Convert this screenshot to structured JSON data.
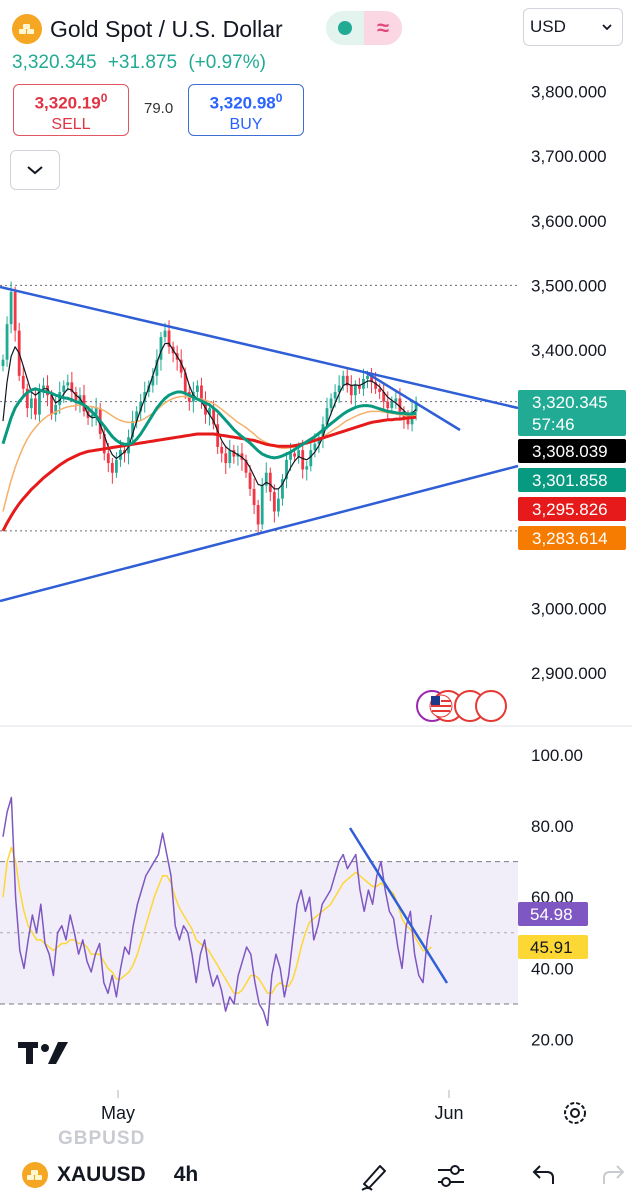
{
  "header": {
    "title": "Gold Spot / U.S. Dollar",
    "last_price": "3,320.345",
    "change": "+31.875",
    "change_pct": "(+0.97%)",
    "sell": {
      "price_main": "3,320.19",
      "price_sup": "0",
      "label": "SELL"
    },
    "buy": {
      "price_main": "3,320.98",
      "price_sup": "0",
      "label": "BUY"
    },
    "spread": "79.0",
    "currency": "USD",
    "delay_icon": "≈"
  },
  "colors": {
    "up": "#22ab94",
    "down": "#f23645",
    "trendline": "#2f5ed6",
    "ma_black": "#131722",
    "ma_green": "#089981",
    "ma_red": "#e61a1a",
    "ma_orange": "#f5b06a",
    "rsi": "#7e57c2",
    "rsi_ma": "#fdd835"
  },
  "chart_data": [
    {
      "type": "candlestick",
      "symbol": "XAUUSD",
      "interval": "4h",
      "y_ticks": [
        "3,800.000",
        "3,700.000",
        "3,600.000",
        "3,500.000",
        "3,400.000",
        "3,000.000",
        "2,900.000"
      ],
      "ylim": [
        2860,
        3860
      ],
      "x_ticks": [
        "May",
        "Jun"
      ],
      "price_labels": [
        {
          "value": 3320.345,
          "text": "3,320.345",
          "sub": "57:46",
          "color": "#22ab94"
        },
        {
          "value": 3308.039,
          "text": "3,308.039",
          "color": "#000000"
        },
        {
          "value": 3301.858,
          "text": "3,301.858",
          "color": "#089981"
        },
        {
          "value": 3295.826,
          "text": "3,295.826",
          "color": "#e61a1a"
        },
        {
          "value": 3283.614,
          "text": "3,283.614",
          "color": "#f57c00"
        }
      ],
      "horizontal_levels": [
        3500,
        3320,
        3120
      ],
      "close_series": [
        3385,
        3440,
        3490,
        3430,
        3360,
        3340,
        3310,
        3325,
        3300,
        3340,
        3345,
        3330,
        3300,
        3315,
        3335,
        3345,
        3350,
        3335,
        3320,
        3330,
        3305,
        3295,
        3300,
        3310,
        3270,
        3240,
        3225,
        3210,
        3230,
        3245,
        3240,
        3265,
        3290,
        3305,
        3320,
        3335,
        3345,
        3360,
        3385,
        3420,
        3430,
        3405,
        3395,
        3385,
        3365,
        3335,
        3320,
        3335,
        3345,
        3320,
        3300,
        3310,
        3285,
        3250,
        3240,
        3225,
        3245,
        3235,
        3240,
        3230,
        3210,
        3185,
        3160,
        3130,
        3190,
        3210,
        3180,
        3150,
        3170,
        3200,
        3230,
        3240,
        3235,
        3245,
        3215,
        3220,
        3245,
        3255,
        3265,
        3285,
        3310,
        3325,
        3335,
        3345,
        3360,
        3345,
        3330,
        3345,
        3340,
        3355,
        3360,
        3350,
        3340,
        3335,
        3320,
        3310,
        3320,
        3325,
        3305,
        3295,
        3285,
        3305,
        3320
      ],
      "ema_black": [
        3290,
        3350,
        3390,
        3405,
        3395,
        3375,
        3355,
        3335,
        3330,
        3335,
        3340,
        3340,
        3330,
        3318,
        3322,
        3332,
        3340,
        3338,
        3330,
        3325,
        3315,
        3300,
        3295,
        3296,
        3285,
        3268,
        3250,
        3238,
        3232,
        3237,
        3242,
        3250,
        3270,
        3290,
        3308,
        3325,
        3342,
        3360,
        3380,
        3398,
        3410,
        3410,
        3400,
        3390,
        3380,
        3365,
        3345,
        3330,
        3325,
        3320,
        3310,
        3300,
        3290,
        3275,
        3260,
        3250,
        3245,
        3242,
        3238,
        3234,
        3228,
        3218,
        3205,
        3192,
        3190,
        3195,
        3192,
        3185,
        3185,
        3192,
        3205,
        3218,
        3228,
        3235,
        3232,
        3230,
        3235,
        3242,
        3252,
        3266,
        3285,
        3302,
        3318,
        3332,
        3345,
        3348,
        3345,
        3346,
        3345,
        3348,
        3352,
        3352,
        3348,
        3343,
        3335,
        3327,
        3322,
        3318,
        3312,
        3306,
        3300,
        3302,
        3308
      ],
      "sma_green": [
        3255,
        3275,
        3295,
        3310,
        3320,
        3328,
        3334,
        3338,
        3340,
        3338,
        3336,
        3335,
        3333,
        3330,
        3328,
        3326,
        3325,
        3323,
        3320,
        3318,
        3315,
        3310,
        3304,
        3298,
        3290,
        3282,
        3274,
        3266,
        3260,
        3256,
        3254,
        3254,
        3256,
        3262,
        3270,
        3280,
        3290,
        3300,
        3310,
        3318,
        3325,
        3330,
        3333,
        3335,
        3335,
        3333,
        3330,
        3327,
        3324,
        3321,
        3318,
        3315,
        3310,
        3305,
        3298,
        3291,
        3284,
        3277,
        3271,
        3266,
        3261,
        3256,
        3250,
        3244,
        3239,
        3236,
        3234,
        3233,
        3234,
        3236,
        3239,
        3242,
        3246,
        3250,
        3254,
        3258,
        3262,
        3266,
        3271,
        3276,
        3281,
        3286,
        3291,
        3296,
        3301,
        3305,
        3308,
        3311,
        3313,
        3314,
        3314,
        3313,
        3311,
        3309,
        3307,
        3305,
        3304,
        3303,
        3302,
        3302,
        3301,
        3301,
        3302
      ],
      "sma_red": [
        3120,
        3132,
        3143,
        3153,
        3162,
        3170,
        3177,
        3184,
        3190,
        3196,
        3202,
        3207,
        3212,
        3217,
        3222,
        3226,
        3230,
        3233,
        3236,
        3239,
        3241,
        3243,
        3244,
        3245,
        3246,
        3247,
        3248,
        3249,
        3250,
        3251,
        3252,
        3253,
        3254,
        3255,
        3256,
        3257,
        3258,
        3259,
        3260,
        3261,
        3262,
        3263,
        3264,
        3265,
        3266,
        3267,
        3268,
        3269,
        3270,
        3270,
        3270,
        3270,
        3270,
        3269,
        3268,
        3267,
        3266,
        3265,
        3264,
        3263,
        3262,
        3261,
        3260,
        3258,
        3256,
        3254,
        3253,
        3252,
        3251,
        3251,
        3251,
        3251,
        3252,
        3253,
        3255,
        3256,
        3258,
        3260,
        3262,
        3264,
        3266,
        3268,
        3270,
        3272,
        3274,
        3276,
        3278,
        3280,
        3282,
        3284,
        3286,
        3288,
        3289,
        3290,
        3291,
        3292,
        3292,
        3293,
        3293,
        3294,
        3295,
        3295,
        3296
      ],
      "ema_orange": [
        3150,
        3175,
        3198,
        3218,
        3235,
        3250,
        3262,
        3272,
        3280,
        3287,
        3293,
        3298,
        3301,
        3304,
        3307,
        3310,
        3312,
        3313,
        3314,
        3315,
        3314,
        3313,
        3312,
        3311,
        3309,
        3306,
        3302,
        3298,
        3294,
        3291,
        3289,
        3288,
        3288,
        3289,
        3291,
        3294,
        3298,
        3302,
        3307,
        3313,
        3318,
        3322,
        3325,
        3327,
        3328,
        3328,
        3327,
        3326,
        3325,
        3324,
        3322,
        3320,
        3317,
        3313,
        3308,
        3303,
        3298,
        3293,
        3288,
        3284,
        3280,
        3275,
        3270,
        3264,
        3260,
        3257,
        3254,
        3251,
        3249,
        3248,
        3248,
        3249,
        3250,
        3252,
        3253,
        3255,
        3257,
        3260,
        3263,
        3266,
        3270,
        3274,
        3278,
        3282,
        3287,
        3291,
        3294,
        3297,
        3300,
        3302,
        3304,
        3305,
        3305,
        3305,
        3304,
        3303,
        3302,
        3301,
        3300,
        3299,
        3298,
        3298,
        3299
      ]
    },
    {
      "type": "line",
      "name": "RSI",
      "y_ticks": [
        "100.00",
        "80.00",
        "60.00",
        "40.00",
        "20.00"
      ],
      "ylim": [
        15,
        105
      ],
      "band": [
        30,
        70
      ],
      "midline": 50,
      "value_labels": [
        {
          "value": 54.98,
          "text": "54.98",
          "color": "#7e57c2"
        },
        {
          "value": 45.91,
          "text": "45.91",
          "color": "#fdd835"
        }
      ],
      "rsi_series": [
        77,
        84,
        88,
        60,
        45,
        40,
        48,
        55,
        50,
        58,
        47,
        44,
        38,
        50,
        52,
        48,
        55,
        50,
        44,
        48,
        42,
        39,
        44,
        47,
        36,
        33,
        38,
        32,
        40,
        46,
        44,
        52,
        58,
        62,
        66,
        68,
        70,
        72,
        78,
        72,
        66,
        52,
        48,
        52,
        50,
        44,
        36,
        44,
        48,
        40,
        35,
        38,
        34,
        28,
        32,
        30,
        38,
        42,
        46,
        44,
        36,
        30,
        28,
        24,
        38,
        44,
        40,
        32,
        38,
        48,
        58,
        62,
        56,
        60,
        48,
        52,
        58,
        60,
        62,
        66,
        70,
        72,
        68,
        70,
        72,
        62,
        56,
        62,
        58,
        66,
        70,
        62,
        56,
        54,
        46,
        40,
        52,
        56,
        44,
        38,
        36,
        48,
        55
      ],
      "rsi_ma": [
        60,
        70,
        74,
        70,
        62,
        56,
        52,
        50,
        48,
        48,
        47,
        46,
        45,
        46,
        47,
        47,
        48,
        48,
        47,
        47,
        46,
        44,
        44,
        44,
        42,
        40,
        39,
        37,
        37,
        38,
        39,
        41,
        44,
        48,
        52,
        56,
        60,
        63,
        66,
        66,
        64,
        60,
        57,
        55,
        53,
        51,
        48,
        47,
        46,
        45,
        43,
        41,
        39,
        37,
        35,
        33,
        33,
        34,
        36,
        38,
        38,
        37,
        35,
        33,
        33,
        35,
        36,
        35,
        35,
        37,
        41,
        46,
        50,
        53,
        54,
        55,
        56,
        57,
        58,
        60,
        62,
        64,
        65,
        66,
        67,
        66,
        65,
        64,
        63,
        63,
        64,
        63,
        62,
        61,
        58,
        54,
        52,
        51,
        49,
        47,
        45,
        45,
        46
      ]
    }
  ],
  "drawings": {
    "label": "trend-lines"
  },
  "bottom": {
    "ghost_symbol": "GBPUSD",
    "symbol": "XAUUSD",
    "interval": "4h"
  },
  "icons": [
    "gold-coin-icon",
    "market-open-icon",
    "delay-icon",
    "chevron-down-icon",
    "settings-icon",
    "events-icon",
    "tradingview-logo-icon",
    "brush-icon",
    "sliders-icon",
    "undo-icon",
    "redo-icon"
  ]
}
